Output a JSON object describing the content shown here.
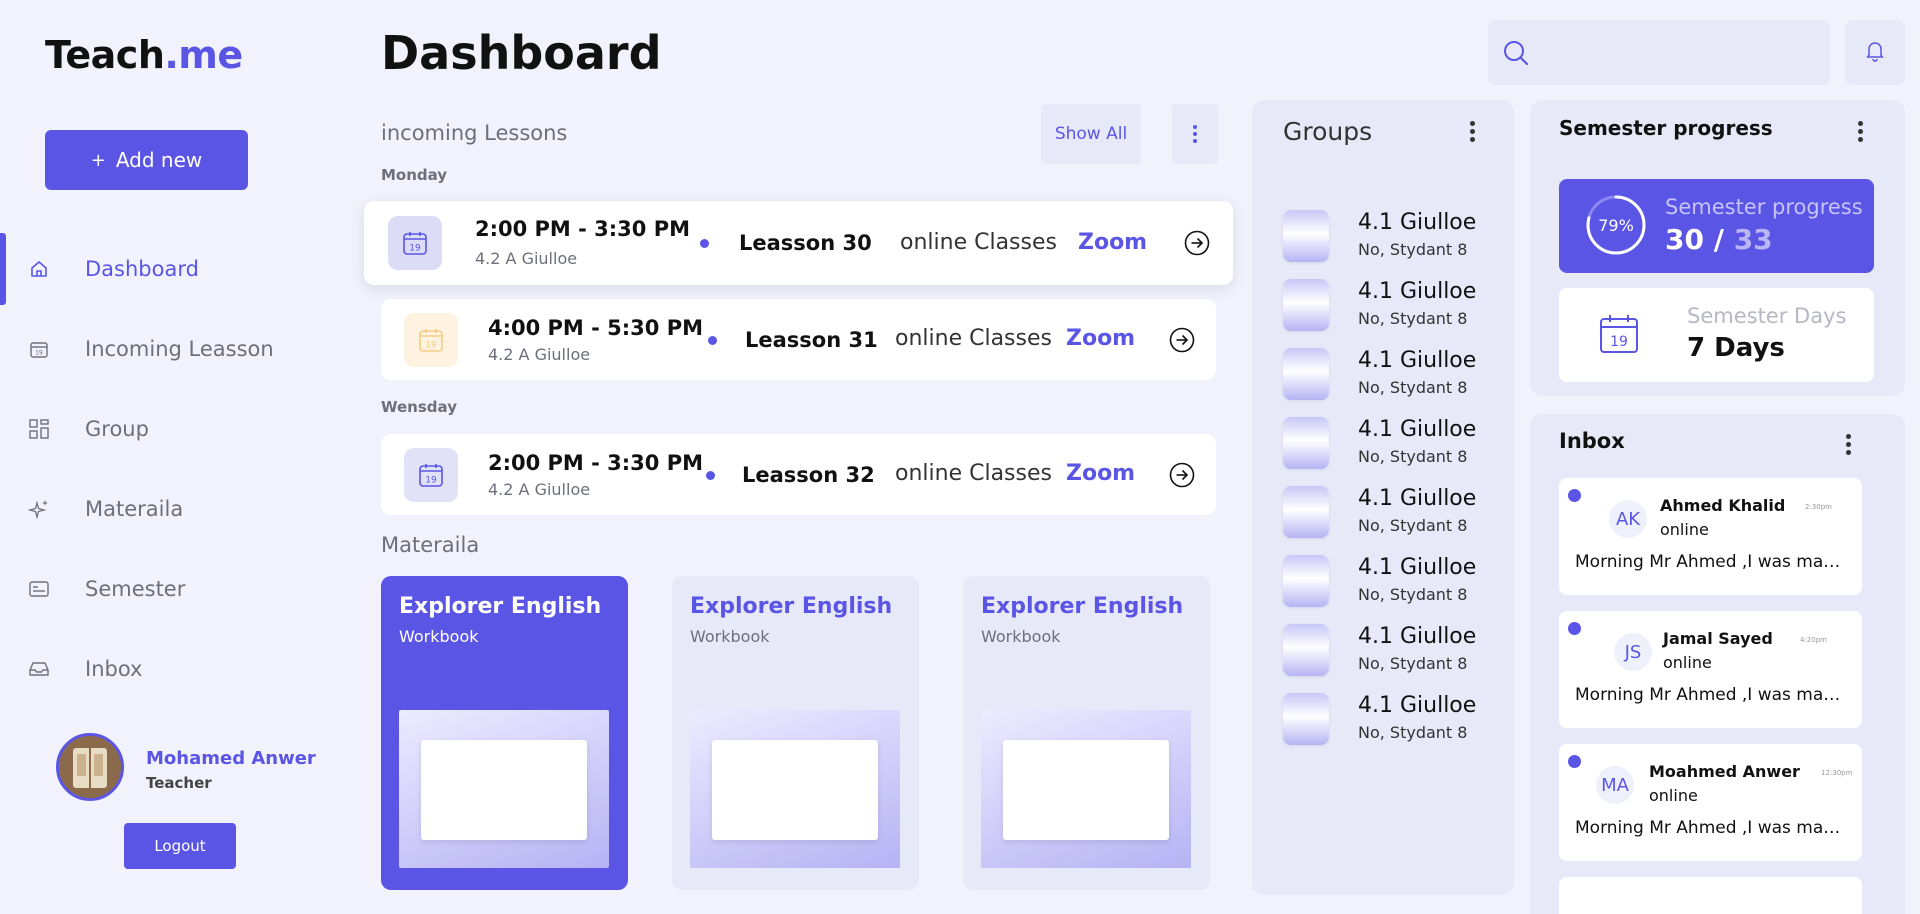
{
  "app": {
    "logo_main": "Teach",
    "logo_accent": ".me",
    "accent_color": "#5b55e6"
  },
  "sidebar": {
    "add_new_label": "Add new",
    "add_new_icon": "plus",
    "items": [
      {
        "label": "Dashboard",
        "icon": "home-icon",
        "active": true
      },
      {
        "label": "Incoming Leasson",
        "icon": "calendar-icon",
        "active": false
      },
      {
        "label": "Group",
        "icon": "grid-icon",
        "active": false
      },
      {
        "label": "Materaila",
        "icon": "sparkle-icon",
        "active": false
      },
      {
        "label": "Semester",
        "icon": "card-icon",
        "active": false
      },
      {
        "label": "Inbox",
        "icon": "inbox-icon",
        "active": false
      }
    ],
    "user": {
      "name": "Mohamed Anwer",
      "role": "Teacher"
    },
    "logout_label": "Logout"
  },
  "header": {
    "title": "Dashboard",
    "search_icon": "search-icon",
    "bell_icon": "bell-icon"
  },
  "lessons": {
    "title": "incoming Lessons",
    "show_all": "Show All",
    "days": [
      "Monday",
      "Wensday"
    ],
    "items": [
      {
        "day": "Monday",
        "time": "2:00 PM - 3:30 PM",
        "group": "4.2 A Giulloe",
        "name": "Leasson 30",
        "type": "online Classes",
        "platform": "Zoom",
        "date_badge": "19"
      },
      {
        "day": "Monday",
        "time": "4:00 PM - 5:30 PM",
        "group": "4.2 A Giulloe",
        "name": "Leasson 31",
        "type": "online Classes",
        "platform": "Zoom",
        "date_badge": "19"
      },
      {
        "day": "Wensday",
        "time": "2:00 PM - 3:30 PM",
        "group": "4.2 A Giulloe",
        "name": "Leasson 32",
        "type": "online Classes",
        "platform": "Zoom",
        "date_badge": "19"
      }
    ]
  },
  "materials": {
    "title": "Materaila",
    "items": [
      {
        "title": "Explorer English",
        "subtitle": "Workbook"
      },
      {
        "title": "Explorer English",
        "subtitle": "Workbook"
      },
      {
        "title": "Explorer English",
        "subtitle": "Workbook"
      }
    ]
  },
  "groups": {
    "title": "Groups",
    "items": [
      {
        "name": "4.1 Giulloe",
        "students": "No, Stydant 8"
      },
      {
        "name": "4.1 Giulloe",
        "students": "No, Stydant 8"
      },
      {
        "name": "4.1 Giulloe",
        "students": "No, Stydant 8"
      },
      {
        "name": "4.1 Giulloe",
        "students": "No, Stydant 8"
      },
      {
        "name": "4.1 Giulloe",
        "students": "No, Stydant 8"
      },
      {
        "name": "4.1 Giulloe",
        "students": "No, Stydant 8"
      },
      {
        "name": "4.1 Giulloe",
        "students": "No, Stydant 8"
      },
      {
        "name": "4.1 Giulloe",
        "students": "No, Stydant 8"
      }
    ]
  },
  "semester": {
    "title": "Semester progress",
    "progress_label": "Semester progress",
    "progress_percent": "79%",
    "progress_value": 0.79,
    "done": "30 /",
    "total": "33",
    "days_label": "Semester Days",
    "days_value": "7 Days",
    "days_badge": "19"
  },
  "inbox": {
    "title": "Inbox",
    "messages": [
      {
        "initials": "AK",
        "name": "Ahmed Khalid",
        "status": "online",
        "time": "2:30pm",
        "text": "Morning Mr Ahmed ,I was made to talk about the project"
      },
      {
        "initials": "JS",
        "name": "Jamal Sayed",
        "status": "online",
        "time": "4:20pm",
        "text": "Morning Mr Ahmed ,I was made to talk about the project"
      },
      {
        "initials": "MA",
        "name": "Moahmed Anwer",
        "status": "online",
        "time": "12:30pm",
        "text": "Morning Mr Ahmed ,I was made to talk about the project"
      }
    ]
  }
}
